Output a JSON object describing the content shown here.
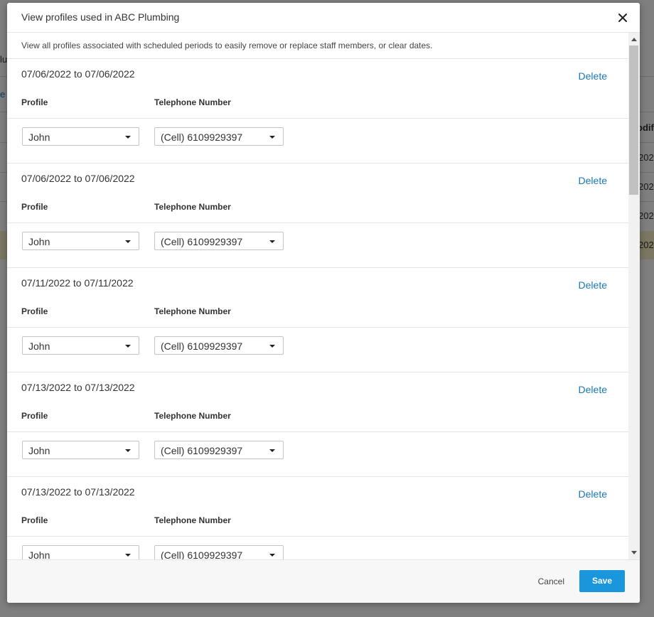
{
  "background": {
    "fragments": [
      "lu",
      "e",
      "odif",
      "202",
      "202",
      "202",
      "202"
    ]
  },
  "dialog": {
    "title": "View profiles used in ABC Plumbing",
    "intro": "View all profiles associated with scheduled periods to easily remove or replace staff members, or clear dates.",
    "delete_label": "Delete",
    "profile_label": "Profile",
    "phone_label": "Telephone Number",
    "periods": [
      {
        "date_range": "07/06/2022 to 07/06/2022",
        "profile": "John",
        "phone": "(Cell) 6109929397"
      },
      {
        "date_range": "07/06/2022 to 07/06/2022",
        "profile": "John",
        "phone": "(Cell) 6109929397"
      },
      {
        "date_range": "07/11/2022 to 07/11/2022",
        "profile": "John",
        "phone": "(Cell) 6109929397"
      },
      {
        "date_range": "07/13/2022 to 07/13/2022",
        "profile": "John",
        "phone": "(Cell) 6109929397"
      },
      {
        "date_range": "07/13/2022 to 07/13/2022",
        "profile": "John",
        "phone": "(Cell) 6109929397"
      }
    ],
    "cancel_label": "Cancel",
    "save_label": "Save"
  },
  "colors": {
    "accent": "#1a96dd",
    "link": "#1a78b5"
  },
  "icons": {
    "close": "close-icon",
    "dropdown": "chevron-down-icon"
  }
}
